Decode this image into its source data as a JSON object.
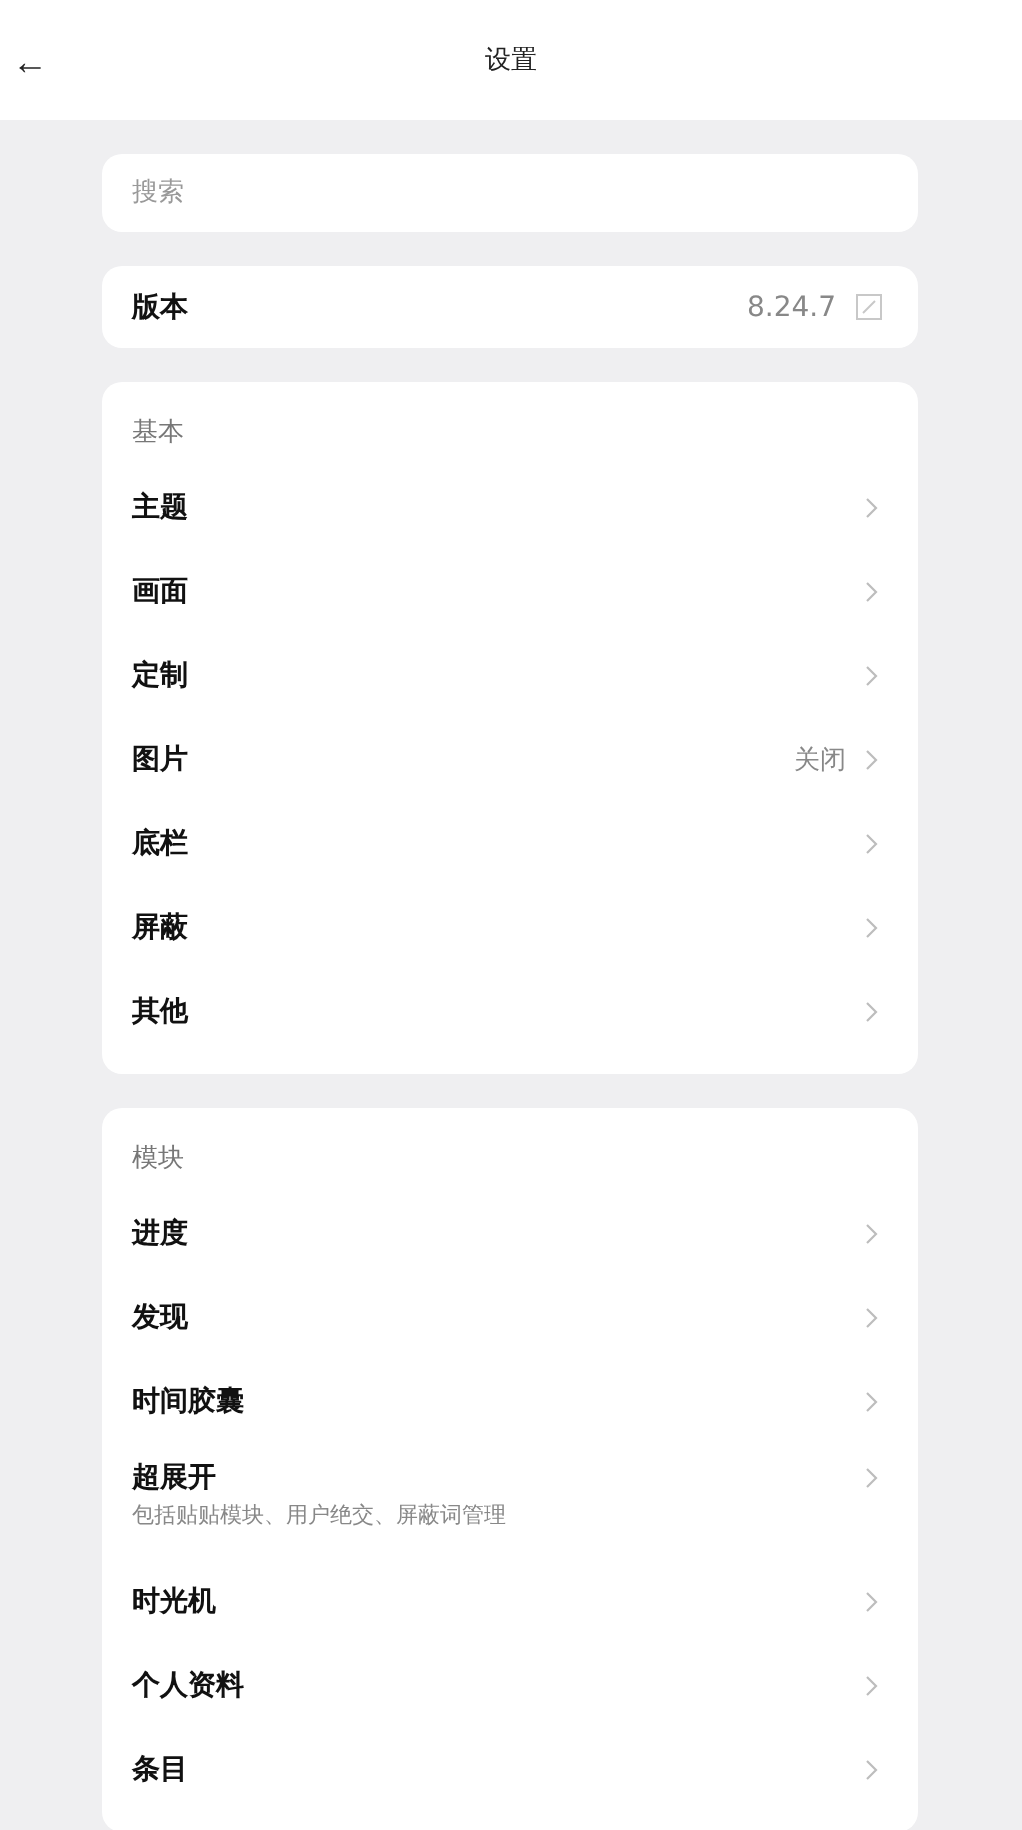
{
  "header": {
    "back": "←",
    "title": "设置"
  },
  "search": {
    "placeholder": "搜索"
  },
  "version": {
    "label": "版本",
    "value": "8.24.7"
  },
  "sections": [
    {
      "title": "基本",
      "items": [
        {
          "label": "主题"
        },
        {
          "label": "画面"
        },
        {
          "label": "定制"
        },
        {
          "label": "图片",
          "value": "关闭"
        },
        {
          "label": "底栏"
        },
        {
          "label": "屏蔽"
        },
        {
          "label": "其他"
        }
      ]
    },
    {
      "title": "模块",
      "items": [
        {
          "label": "进度"
        },
        {
          "label": "发现"
        },
        {
          "label": "时间胶囊"
        },
        {
          "label": "超展开",
          "description": "包括贴贴模块、用户绝交、屏蔽词管理"
        },
        {
          "label": "时光机"
        },
        {
          "label": "个人资料"
        },
        {
          "label": "条目"
        }
      ]
    }
  ]
}
